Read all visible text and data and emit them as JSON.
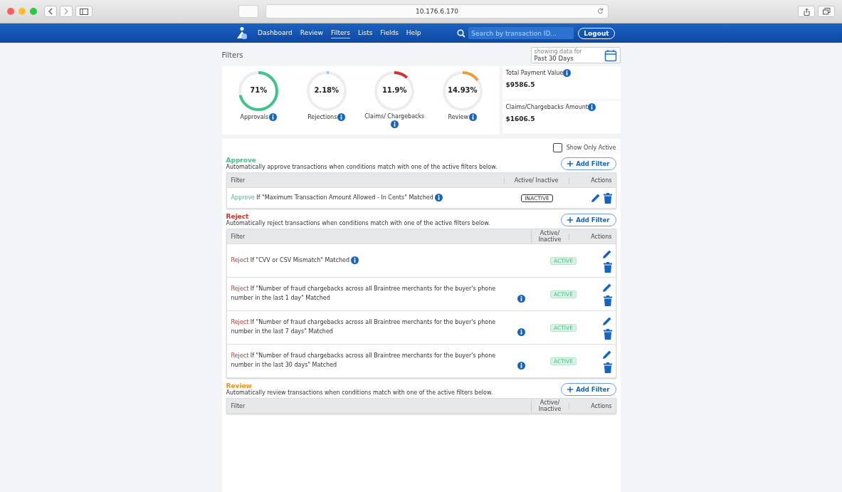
{
  "browser": {
    "address": "10.176.6.170"
  },
  "nav": {
    "items": [
      {
        "label": "Dashboard",
        "selected": false
      },
      {
        "label": "Review",
        "selected": false
      },
      {
        "label": "Filters",
        "selected": true
      },
      {
        "label": "Lists",
        "selected": false
      },
      {
        "label": "Fields",
        "selected": false
      },
      {
        "label": "Help",
        "selected": false
      }
    ],
    "search_placeholder": "Search by transaction ID...",
    "logout": "Logout"
  },
  "page": {
    "title": "Filters",
    "date_caption": "showing data for",
    "date_value": "Past 30 Days"
  },
  "gauges": [
    {
      "value": "71%",
      "label": "Approvals",
      "level": 0.71,
      "color": "#3ec48a"
    },
    {
      "value": "2.18%",
      "label": "Rejections",
      "level": 0.0218,
      "color": "#a8c8e8"
    },
    {
      "value": "11.9%",
      "label": "Claims/ Chargebacks",
      "level": 0.119,
      "color": "#d0332b"
    },
    {
      "value": "14.93%",
      "label": "Review",
      "level": 0.1493,
      "color": "#e8a03a"
    }
  ],
  "totals": [
    {
      "label": "Total Payment Value",
      "value": "$9586.5"
    },
    {
      "label": "Claims/Chargebacks Amount",
      "value": "$1606.5"
    }
  ],
  "show_only_active": {
    "label": "Show Only Active",
    "checked": false
  },
  "sections": [
    {
      "kind": "approve",
      "title": "Approve",
      "description": "Automatically approve transactions when conditions match with one of the active filters below.",
      "add_button": "Add Filter",
      "columns": [
        "Filter",
        "Active/ Inactive",
        "Actions"
      ],
      "rows": [
        {
          "verb": "Approve",
          "text": "If \"Maximum Transaction Amount Allowed - In Cents\" Matched",
          "status": "INACTIVE",
          "active": false
        }
      ]
    },
    {
      "kind": "reject",
      "title": "Reject",
      "description": "Automatically reject transactions when conditions match with one of the active filters below.",
      "add_button": "Add Filter",
      "columns": [
        "Filter",
        "Active/ Inactive",
        "Actions"
      ],
      "rows": [
        {
          "verb": "Reject",
          "text": "If \"CVV or CSV Mismatch\" Matched",
          "status": "ACTIVE",
          "active": true
        },
        {
          "verb": "Reject",
          "text": "If \"Number of fraud chargebacks across all Braintree merchants for the buyer's phone number in the last 1 day\" Matched",
          "status": "ACTIVE",
          "active": true
        },
        {
          "verb": "Reject",
          "text": "If \"Number of fraud chargebacks across all Braintree merchants for the buyer's phone number in the last 7 days\" Matched",
          "status": "ACTIVE",
          "active": true
        },
        {
          "verb": "Reject",
          "text": "If \"Number of fraud chargebacks across all Braintree merchants for the buyer's phone number in the last 30 days\" Matched",
          "status": "ACTIVE",
          "active": true
        }
      ]
    },
    {
      "kind": "review",
      "title": "Review",
      "description": "Automatically review transactions when conditions match with one of the active filters below.",
      "add_button": "Add Filter",
      "columns": [
        "Filter",
        "Active/ Inactive",
        "Actions"
      ]
    }
  ]
}
